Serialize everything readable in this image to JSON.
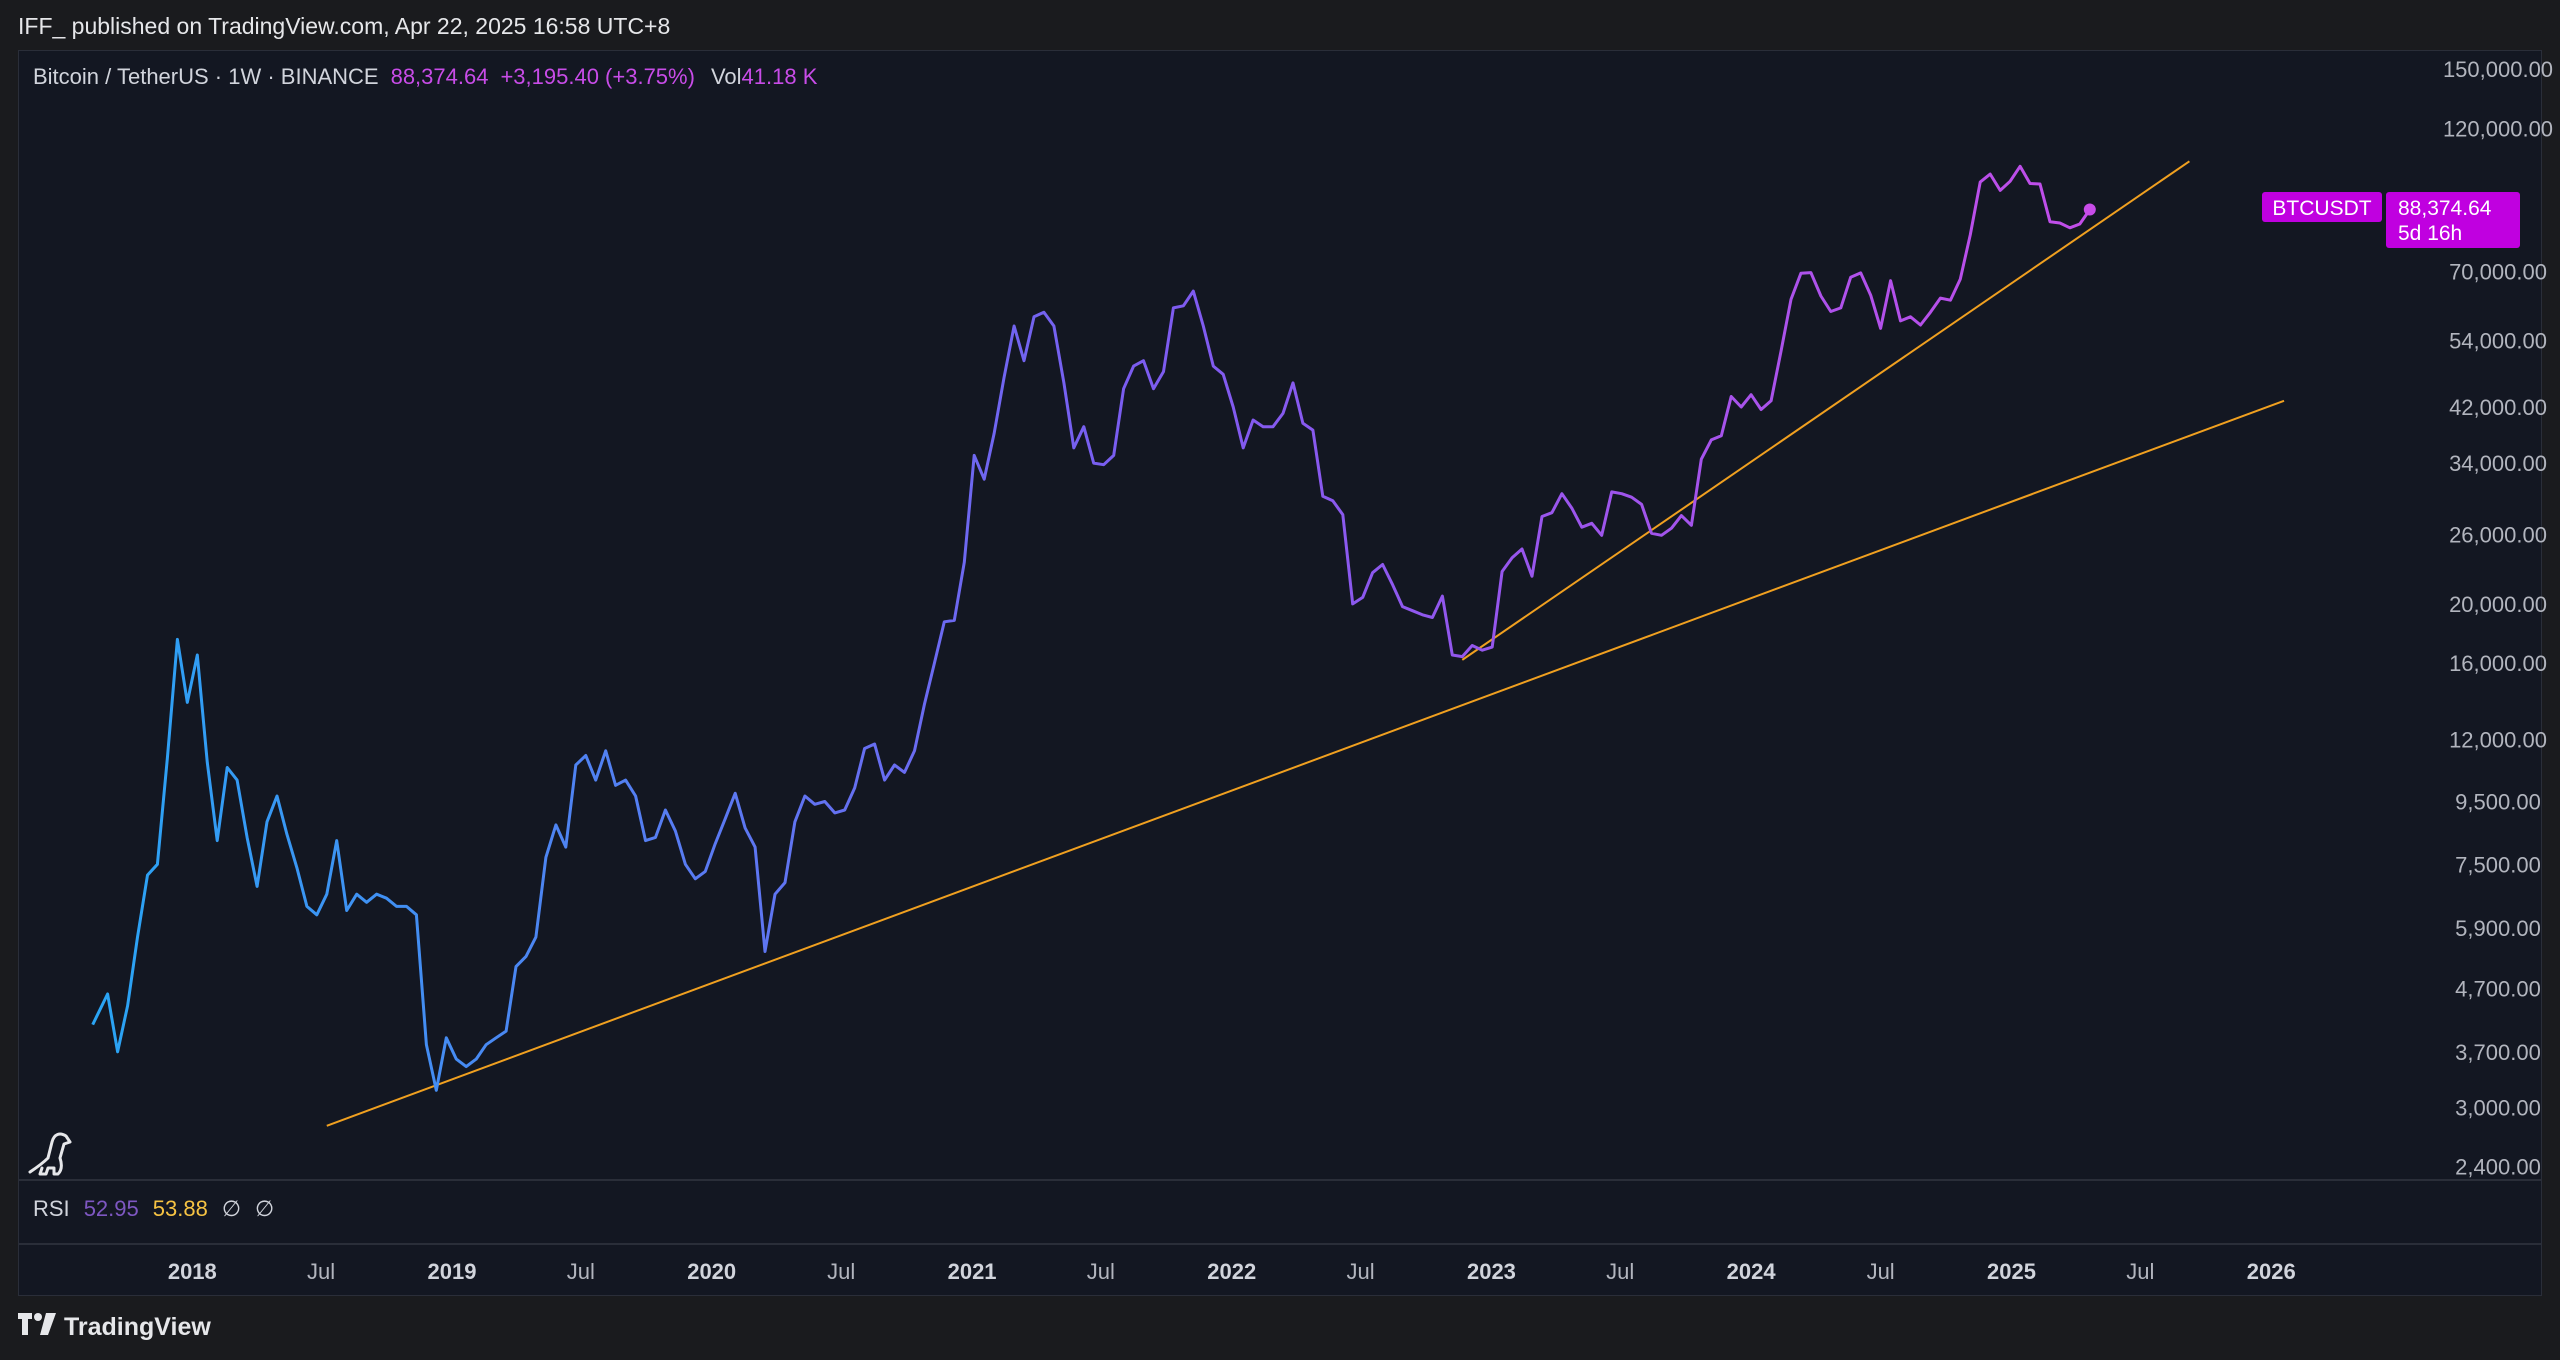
{
  "header": {
    "published_line": "IFF_ published on TradingView.com, Apr 22, 2025 16:58 UTC+8"
  },
  "legend": {
    "symbol": "Bitcoin / TetherUS · 1W · BINANCE",
    "last_price": "88,374.64",
    "change": "+3,195.40 (+3.75%)",
    "vol_label": "Vol",
    "vol_value": "41.18 K"
  },
  "price_badge": {
    "ticker": "BTCUSDT",
    "price": "88,374.64",
    "countdown": "5d 16h"
  },
  "rsi": {
    "label": "RSI",
    "value1": "52.95",
    "value2": "53.88",
    "sym1": "∅",
    "sym2": "∅"
  },
  "footer": {
    "brand": "TradingView",
    "logo_icon": "tradingview-logo-icon"
  },
  "colors": {
    "line_start": "#2aa4f4",
    "line_mid": "#7b5cf0",
    "line_end": "#c84ce8",
    "trendline": "#f0a020",
    "badge": "#c000e0"
  },
  "chart_data": {
    "type": "line",
    "title": "",
    "xlabel": "",
    "ylabel": "",
    "y_scale": "log",
    "ylim": [
      2300,
      160000
    ],
    "xlim": [
      "2017-05-01",
      "2026-07-01"
    ],
    "y_tick_labels": [
      "150,000.00",
      "120,000.00",
      "70,000.00",
      "54,000.00",
      "42,000.00",
      "34,000.00",
      "26,000.00",
      "20,000.00",
      "16,000.00",
      "12,000.00",
      "9,500.00",
      "7,500.00",
      "5,900.00",
      "4,700.00",
      "3,700.00",
      "3,000.00",
      "2,400.00"
    ],
    "y_tick_values": [
      150000,
      120000,
      70000,
      54000,
      42000,
      34000,
      26000,
      20000,
      16000,
      12000,
      9500,
      7500,
      5900,
      4700,
      3700,
      3000,
      2400
    ],
    "x_ticks": [
      {
        "label": "2018",
        "date": "2018-01-01",
        "year": true
      },
      {
        "label": "Jul",
        "date": "2018-07-01",
        "year": false
      },
      {
        "label": "2019",
        "date": "2019-01-01",
        "year": true
      },
      {
        "label": "Jul",
        "date": "2019-07-01",
        "year": false
      },
      {
        "label": "2020",
        "date": "2020-01-01",
        "year": true
      },
      {
        "label": "Jul",
        "date": "2020-07-01",
        "year": false
      },
      {
        "label": "2021",
        "date": "2021-01-01",
        "year": true
      },
      {
        "label": "Jul",
        "date": "2021-07-01",
        "year": false
      },
      {
        "label": "2022",
        "date": "2022-01-01",
        "year": true
      },
      {
        "label": "Jul",
        "date": "2022-07-01",
        "year": false
      },
      {
        "label": "2023",
        "date": "2023-01-01",
        "year": true
      },
      {
        "label": "Jul",
        "date": "2023-07-01",
        "year": false
      },
      {
        "label": "2024",
        "date": "2024-01-01",
        "year": true
      },
      {
        "label": "Jul",
        "date": "2024-07-01",
        "year": false
      },
      {
        "label": "2025",
        "date": "2025-01-01",
        "year": true
      },
      {
        "label": "Jul",
        "date": "2025-07-01",
        "year": false
      },
      {
        "label": "2026",
        "date": "2026-01-01",
        "year": true
      }
    ],
    "series": [
      {
        "name": "BTCUSDT",
        "points": [
          [
            "2017-08-14",
            4100
          ],
          [
            "2017-09-04",
            4600
          ],
          [
            "2017-09-18",
            3700
          ],
          [
            "2017-10-02",
            4400
          ],
          [
            "2017-10-16",
            5700
          ],
          [
            "2017-10-30",
            7200
          ],
          [
            "2017-11-13",
            7500
          ],
          [
            "2017-11-27",
            11200
          ],
          [
            "2017-12-11",
            17500
          ],
          [
            "2017-12-25",
            13800
          ],
          [
            "2018-01-08",
            16500
          ],
          [
            "2018-01-22",
            11000
          ],
          [
            "2018-02-05",
            8200
          ],
          [
            "2018-02-19",
            10800
          ],
          [
            "2018-03-05",
            10300
          ],
          [
            "2018-03-19",
            8300
          ],
          [
            "2018-04-02",
            6900
          ],
          [
            "2018-04-16",
            8800
          ],
          [
            "2018-04-30",
            9700
          ],
          [
            "2018-05-14",
            8400
          ],
          [
            "2018-05-28",
            7400
          ],
          [
            "2018-06-11",
            6400
          ],
          [
            "2018-06-25",
            6200
          ],
          [
            "2018-07-09",
            6700
          ],
          [
            "2018-07-23",
            8200
          ],
          [
            "2018-08-06",
            6300
          ],
          [
            "2018-08-20",
            6700
          ],
          [
            "2018-09-03",
            6500
          ],
          [
            "2018-09-17",
            6700
          ],
          [
            "2018-10-01",
            6600
          ],
          [
            "2018-10-15",
            6400
          ],
          [
            "2018-10-29",
            6400
          ],
          [
            "2018-11-12",
            6200
          ],
          [
            "2018-11-26",
            3800
          ],
          [
            "2018-12-10",
            3200
          ],
          [
            "2018-12-24",
            3900
          ],
          [
            "2019-01-07",
            3600
          ],
          [
            "2019-01-21",
            3500
          ],
          [
            "2019-02-04",
            3600
          ],
          [
            "2019-02-18",
            3800
          ],
          [
            "2019-03-04",
            3900
          ],
          [
            "2019-03-18",
            4000
          ],
          [
            "2019-04-01",
            5100
          ],
          [
            "2019-04-15",
            5300
          ],
          [
            "2019-04-29",
            5700
          ],
          [
            "2019-05-13",
            7700
          ],
          [
            "2019-05-27",
            8700
          ],
          [
            "2019-06-10",
            8000
          ],
          [
            "2019-06-24",
            10900
          ],
          [
            "2019-07-08",
            11300
          ],
          [
            "2019-07-22",
            10300
          ],
          [
            "2019-08-05",
            11500
          ],
          [
            "2019-08-19",
            10100
          ],
          [
            "2019-09-02",
            10300
          ],
          [
            "2019-09-16",
            9700
          ],
          [
            "2019-09-30",
            8200
          ],
          [
            "2019-10-14",
            8300
          ],
          [
            "2019-10-28",
            9200
          ],
          [
            "2019-11-11",
            8500
          ],
          [
            "2019-11-25",
            7500
          ],
          [
            "2019-12-09",
            7100
          ],
          [
            "2019-12-23",
            7300
          ],
          [
            "2020-01-06",
            8100
          ],
          [
            "2020-01-20",
            8900
          ],
          [
            "2020-02-03",
            9800
          ],
          [
            "2020-02-17",
            8600
          ],
          [
            "2020-03-02",
            8000
          ],
          [
            "2020-03-16",
            5400
          ],
          [
            "2020-03-30",
            6700
          ],
          [
            "2020-04-13",
            7000
          ],
          [
            "2020-04-27",
            8800
          ],
          [
            "2020-05-11",
            9700
          ],
          [
            "2020-05-25",
            9400
          ],
          [
            "2020-06-08",
            9500
          ],
          [
            "2020-06-22",
            9100
          ],
          [
            "2020-07-06",
            9200
          ],
          [
            "2020-07-20",
            10000
          ],
          [
            "2020-08-03",
            11600
          ],
          [
            "2020-08-17",
            11800
          ],
          [
            "2020-08-31",
            10300
          ],
          [
            "2020-09-14",
            10900
          ],
          [
            "2020-09-28",
            10600
          ],
          [
            "2020-10-12",
            11500
          ],
          [
            "2020-10-26",
            13700
          ],
          [
            "2020-11-09",
            16000
          ],
          [
            "2020-11-23",
            18700
          ],
          [
            "2020-12-07",
            18800
          ],
          [
            "2020-12-21",
            23400
          ],
          [
            "2021-01-04",
            35000
          ],
          [
            "2021-01-18",
            32000
          ],
          [
            "2021-02-01",
            38000
          ],
          [
            "2021-02-15",
            47000
          ],
          [
            "2021-03-01",
            57000
          ],
          [
            "2021-03-15",
            50000
          ],
          [
            "2021-03-29",
            59000
          ],
          [
            "2021-04-12",
            60000
          ],
          [
            "2021-04-26",
            57000
          ],
          [
            "2021-05-10",
            46000
          ],
          [
            "2021-05-24",
            36000
          ],
          [
            "2021-06-07",
            39000
          ],
          [
            "2021-06-21",
            34000
          ],
          [
            "2021-07-05",
            33800
          ],
          [
            "2021-07-19",
            35000
          ],
          [
            "2021-08-02",
            45000
          ],
          [
            "2021-08-16",
            49000
          ],
          [
            "2021-08-30",
            50000
          ],
          [
            "2021-09-13",
            45000
          ],
          [
            "2021-09-27",
            48000
          ],
          [
            "2021-10-11",
            61000
          ],
          [
            "2021-10-25",
            61500
          ],
          [
            "2021-11-08",
            65000
          ],
          [
            "2021-11-22",
            57000
          ],
          [
            "2021-12-06",
            49000
          ],
          [
            "2021-12-20",
            47500
          ],
          [
            "2022-01-03",
            42000
          ],
          [
            "2022-01-17",
            36000
          ],
          [
            "2022-01-31",
            40000
          ],
          [
            "2022-02-14",
            39000
          ],
          [
            "2022-02-28",
            39000
          ],
          [
            "2022-03-14",
            41000
          ],
          [
            "2022-03-28",
            46000
          ],
          [
            "2022-04-11",
            39500
          ],
          [
            "2022-04-25",
            38500
          ],
          [
            "2022-05-09",
            30000
          ],
          [
            "2022-05-23",
            29500
          ],
          [
            "2022-06-06",
            28000
          ],
          [
            "2022-06-20",
            20000
          ],
          [
            "2022-07-04",
            20500
          ],
          [
            "2022-07-18",
            22500
          ],
          [
            "2022-08-01",
            23200
          ],
          [
            "2022-08-15",
            21500
          ],
          [
            "2022-08-29",
            19800
          ],
          [
            "2022-09-12",
            19500
          ],
          [
            "2022-09-26",
            19200
          ],
          [
            "2022-10-10",
            19000
          ],
          [
            "2022-10-24",
            20600
          ],
          [
            "2022-11-07",
            16500
          ],
          [
            "2022-11-21",
            16400
          ],
          [
            "2022-12-05",
            17100
          ],
          [
            "2022-12-19",
            16800
          ],
          [
            "2023-01-02",
            17000
          ],
          [
            "2023-01-16",
            22600
          ],
          [
            "2023-01-30",
            23800
          ],
          [
            "2023-02-13",
            24600
          ],
          [
            "2023-02-27",
            22200
          ],
          [
            "2023-03-13",
            27800
          ],
          [
            "2023-03-27",
            28200
          ],
          [
            "2023-04-10",
            30300
          ],
          [
            "2023-04-24",
            28700
          ],
          [
            "2023-05-08",
            26700
          ],
          [
            "2023-05-22",
            27100
          ],
          [
            "2023-06-05",
            25900
          ],
          [
            "2023-06-19",
            30500
          ],
          [
            "2023-07-03",
            30300
          ],
          [
            "2023-07-17",
            29900
          ],
          [
            "2023-07-31",
            29100
          ],
          [
            "2023-08-14",
            26100
          ],
          [
            "2023-08-28",
            25900
          ],
          [
            "2023-09-11",
            26600
          ],
          [
            "2023-09-25",
            27900
          ],
          [
            "2023-10-09",
            26900
          ],
          [
            "2023-10-23",
            34500
          ],
          [
            "2023-11-06",
            37100
          ],
          [
            "2023-11-20",
            37700
          ],
          [
            "2023-12-04",
            43700
          ],
          [
            "2023-12-18",
            42000
          ],
          [
            "2024-01-01",
            44000
          ],
          [
            "2024-01-15",
            41600
          ],
          [
            "2024-01-29",
            43000
          ],
          [
            "2024-02-12",
            51800
          ],
          [
            "2024-02-26",
            63000
          ],
          [
            "2024-03-11",
            69500
          ],
          [
            "2024-03-25",
            69700
          ],
          [
            "2024-04-08",
            63800
          ],
          [
            "2024-04-22",
            60200
          ],
          [
            "2024-05-06",
            61000
          ],
          [
            "2024-05-20",
            68500
          ],
          [
            "2024-06-03",
            69600
          ],
          [
            "2024-06-17",
            64000
          ],
          [
            "2024-07-01",
            56500
          ],
          [
            "2024-07-15",
            67600
          ],
          [
            "2024-07-29",
            58100
          ],
          [
            "2024-08-12",
            59000
          ],
          [
            "2024-08-26",
            57200
          ],
          [
            "2024-09-09",
            60000
          ],
          [
            "2024-09-23",
            63300
          ],
          [
            "2024-10-07",
            62800
          ],
          [
            "2024-10-21",
            68000
          ],
          [
            "2024-11-04",
            80400
          ],
          [
            "2024-11-18",
            98000
          ],
          [
            "2024-12-02",
            101000
          ],
          [
            "2024-12-16",
            95000
          ],
          [
            "2024-12-30",
            98300
          ],
          [
            "2025-01-13",
            104000
          ],
          [
            "2025-01-27",
            97500
          ],
          [
            "2025-02-10",
            97300
          ],
          [
            "2025-02-24",
            84400
          ],
          [
            "2025-03-10",
            84000
          ],
          [
            "2025-03-24",
            82500
          ],
          [
            "2025-04-07",
            83700
          ],
          [
            "2025-04-21",
            88374.64
          ]
        ]
      }
    ],
    "trendlines": [
      {
        "name": "",
        "from": [
          "2018-07-09",
          2800
        ],
        "to": [
          "2026-01-19",
          43000
        ]
      },
      {
        "name": "",
        "from": [
          "2022-11-21",
          16200
        ],
        "to": [
          "2025-09-08",
          106000
        ]
      }
    ]
  }
}
